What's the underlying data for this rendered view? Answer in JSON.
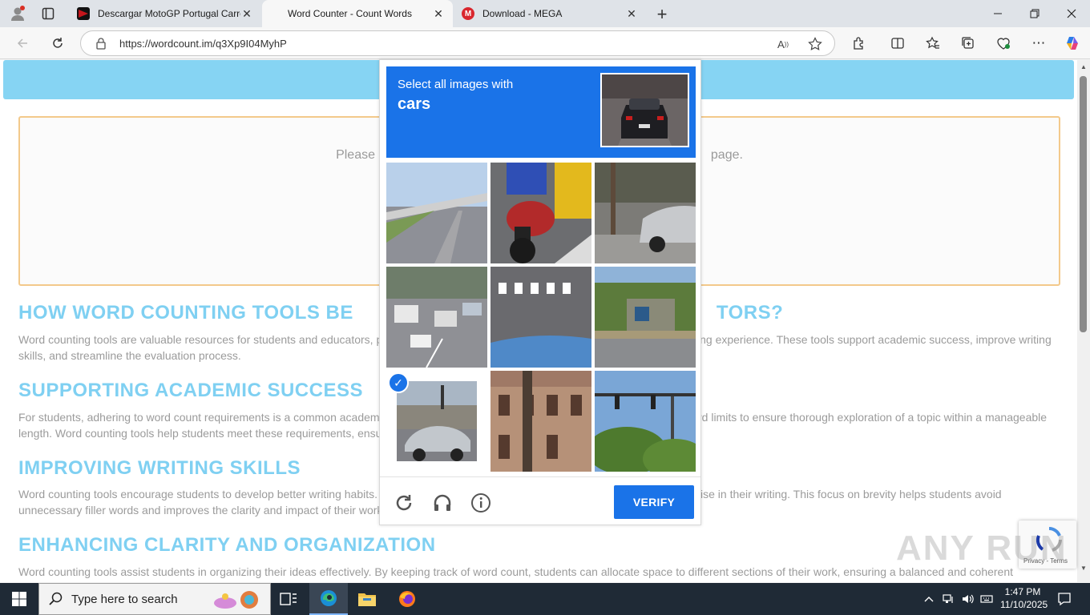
{
  "browser": {
    "tabs": [
      {
        "title": "Descargar MotoGP Portugal Carre",
        "active": false
      },
      {
        "title": "Word Counter - Count Words",
        "active": true
      },
      {
        "title": "Download - MEGA",
        "active": false
      }
    ],
    "url": "https://wordcount.im/q3Xp9I04MyhP",
    "favicon_mega": "M"
  },
  "page": {
    "input_placeholder_left": "Please",
    "input_placeholder_right": "page.",
    "sections": [
      {
        "heading": "HOW WORD COUNTING TOOLS BE",
        "heading_tail": "TORS?",
        "text_left": "Word counting tools are valuable resources for students and educators, p",
        "text_right": "ing experience. These tools support academic success, improve writing",
        "text_line2": "skills, and streamline the evaluation process."
      },
      {
        "heading": "SUPPORTING ACADEMIC SUCCESS",
        "heading_tail": "",
        "text_left": "For students, adhering to word count requirements is a common academ",
        "text_right": "rd limits to ensure thorough exploration of a topic within a manageable",
        "text_line2": "length. Word counting tools help students meet these requirements, ensu"
      },
      {
        "heading": "IMPROVING WRITING SKILLS",
        "heading_tail": "",
        "text_left": "Word counting tools encourage students to develop better writing habits.",
        "text_right": "ise in their writing. This focus on brevity helps students avoid",
        "text_line2": "unnecessary filler words and improves the clarity and impact of their work"
      },
      {
        "heading": "ENHANCING CLARITY AND ORGANIZATION",
        "heading_tail": "",
        "text_left": "Word counting tools assist students in organizing their ideas effectively. By keeping track of word count, students can allocate space to different sections of their work, ensuring a balanced and coherent",
        "text_right": "",
        "text_line2": ""
      }
    ]
  },
  "captcha": {
    "instruction": "Select all images with",
    "target": "cars",
    "verify_label": "VERIFY",
    "selected_cell": 6,
    "check_mark": "✓"
  },
  "recaptcha_badge": {
    "text": "Privacy - Terms"
  },
  "watermark": "ANY RUN",
  "taskbar": {
    "search_placeholder": "Type here to search",
    "time": "1:47 PM",
    "date": "11/10/2025"
  },
  "colors": {
    "accent": "#1a73e8",
    "heading": "#7fd0f2",
    "banner": "#86d4f3",
    "input_border": "#f3c98b",
    "taskbar": "#1f2a36"
  }
}
